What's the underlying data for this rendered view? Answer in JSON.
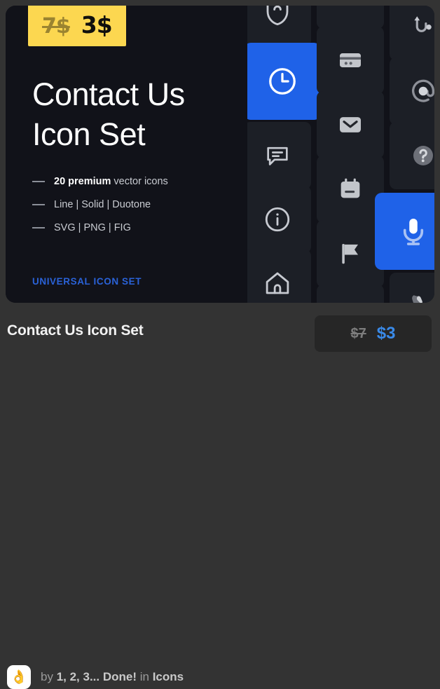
{
  "card": {
    "promo_badge": {
      "old_price": "7$",
      "new_price": "3$",
      "badge_color": "#FCD750"
    },
    "headline": "Contact Us\nIcon Set",
    "features": [
      {
        "strong": "20 premium",
        "rest": " vector icons"
      },
      {
        "strong": "",
        "rest": "Line | Solid | Duotone"
      },
      {
        "strong": "",
        "rest": "SVG | PNG | FIG"
      }
    ],
    "tagline": "UNIVERSAL ICON SET",
    "tagline_color": "#2a62d8",
    "accent_color": "#1f62e8",
    "tile_color": "#1c1f26",
    "panel_color": "#111219"
  },
  "icon_grid": {
    "columns": [
      {
        "name": "line-style-column",
        "icons": [
          "shield-icon",
          "clock-icon",
          "chat-bubble-icon",
          "info-circle-icon",
          "home-icon"
        ]
      },
      {
        "name": "solid-style-column",
        "icons": [
          "credit-card-icon",
          "envelope-icon",
          "calendar-icon",
          "flag-icon"
        ]
      },
      {
        "name": "duotone-style-column",
        "icons": [
          "route-icon",
          "at-sign-icon",
          "question-mark-icon",
          "microphone-icon",
          "phone-icon"
        ]
      }
    ],
    "highlighted": [
      "clock-icon",
      "microphone-icon"
    ]
  },
  "meta": {
    "title": "Contact Us Icon Set",
    "price": {
      "old": "$7",
      "new": "$3",
      "old_color": "#7d7d7d",
      "new_color": "#3a8ae8"
    },
    "author": {
      "avatar_emoji": "👌",
      "prefix": "by ",
      "name": "1, 2, 3... Done!",
      "separator": " in ",
      "category": "Icons"
    }
  }
}
